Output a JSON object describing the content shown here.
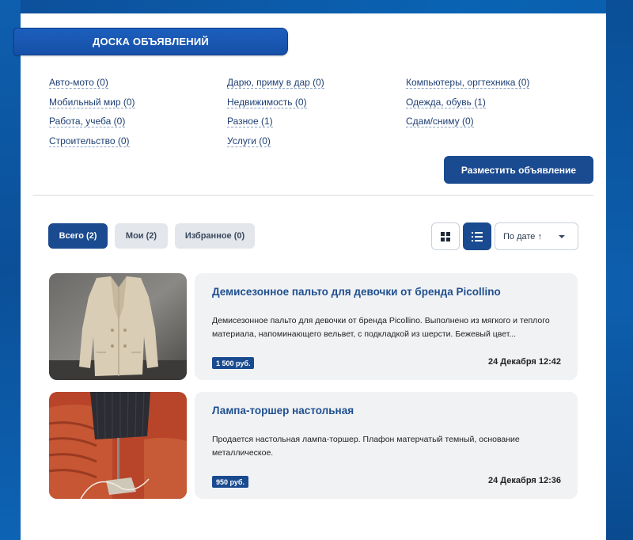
{
  "board": {
    "title": "ДОСКА ОБЪЯВЛЕНИЙ"
  },
  "categories": {
    "col1": [
      "Авто-мото (0)",
      "Мобильный мир (0)",
      "Работа, учеба (0)",
      "Строительство (0)"
    ],
    "col2": [
      "Дарю, приму в дар (0)",
      "Недвижимость (0)",
      "Разное (1)",
      "Услуги (0)"
    ],
    "col3": [
      "Компьютеры, оргтехника (0)",
      "Одежда, обувь (1)",
      "Сдам/сниму (0)"
    ]
  },
  "actions": {
    "post_label": "Разместить объявление"
  },
  "tabs": [
    {
      "label": "Всего (2)",
      "active": true
    },
    {
      "label": "Мои (2)",
      "active": false
    },
    {
      "label": "Избранное (0)",
      "active": false
    }
  ],
  "view": {
    "mode": "list",
    "grid_icon": "grid-icon",
    "list_icon": "list-icon"
  },
  "sort": {
    "selected": "По дате ↑"
  },
  "listings": [
    {
      "title": "Демисезонное пальто для девочки от бренда Picollino",
      "description": "Демисезонное пальто для девочки от бренда Picollino. Выполнено из мягкого и теплого материала, напоминающего вельвет, с подкладкой из шерсти. Бежевый цвет...",
      "price": "1 500 руб.",
      "date": "24 Декабря 12:42"
    },
    {
      "title": "Лампа-торшер настольная",
      "description": "Продается настольная лампа-торшер. Плафон матерчатый темный, основание металлическое.",
      "price": "950 руб.",
      "date": "24 Декабря 12:36"
    }
  ],
  "colors": {
    "accent": "#1a4a8f",
    "link": "#1e3f73",
    "card_bg": "#f1f2f4"
  }
}
